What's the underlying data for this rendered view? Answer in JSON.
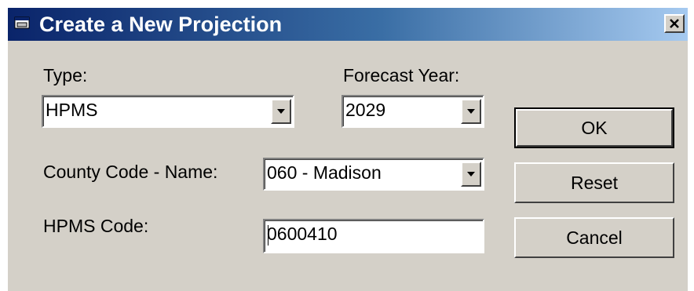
{
  "window": {
    "title": "Create a New Projection",
    "close_label": "x"
  },
  "form": {
    "type": {
      "label": "Type:",
      "value": "HPMS"
    },
    "forecast_year": {
      "label": "Forecast Year:",
      "value": "2029"
    },
    "county": {
      "label": "County Code - Name:",
      "value": "060 - Madison"
    },
    "hpms_code": {
      "label": "HPMS Code:",
      "value": "0600410"
    }
  },
  "buttons": {
    "ok": "OK",
    "reset": "Reset",
    "cancel": "Cancel"
  },
  "colors": {
    "title_gradient_start": "#0a246a",
    "title_gradient_end": "#a6caf0",
    "dialog_face": "#d4d0c8"
  },
  "icons": {
    "app": "dialog-app-icon",
    "dropdown": "triangle-down"
  }
}
